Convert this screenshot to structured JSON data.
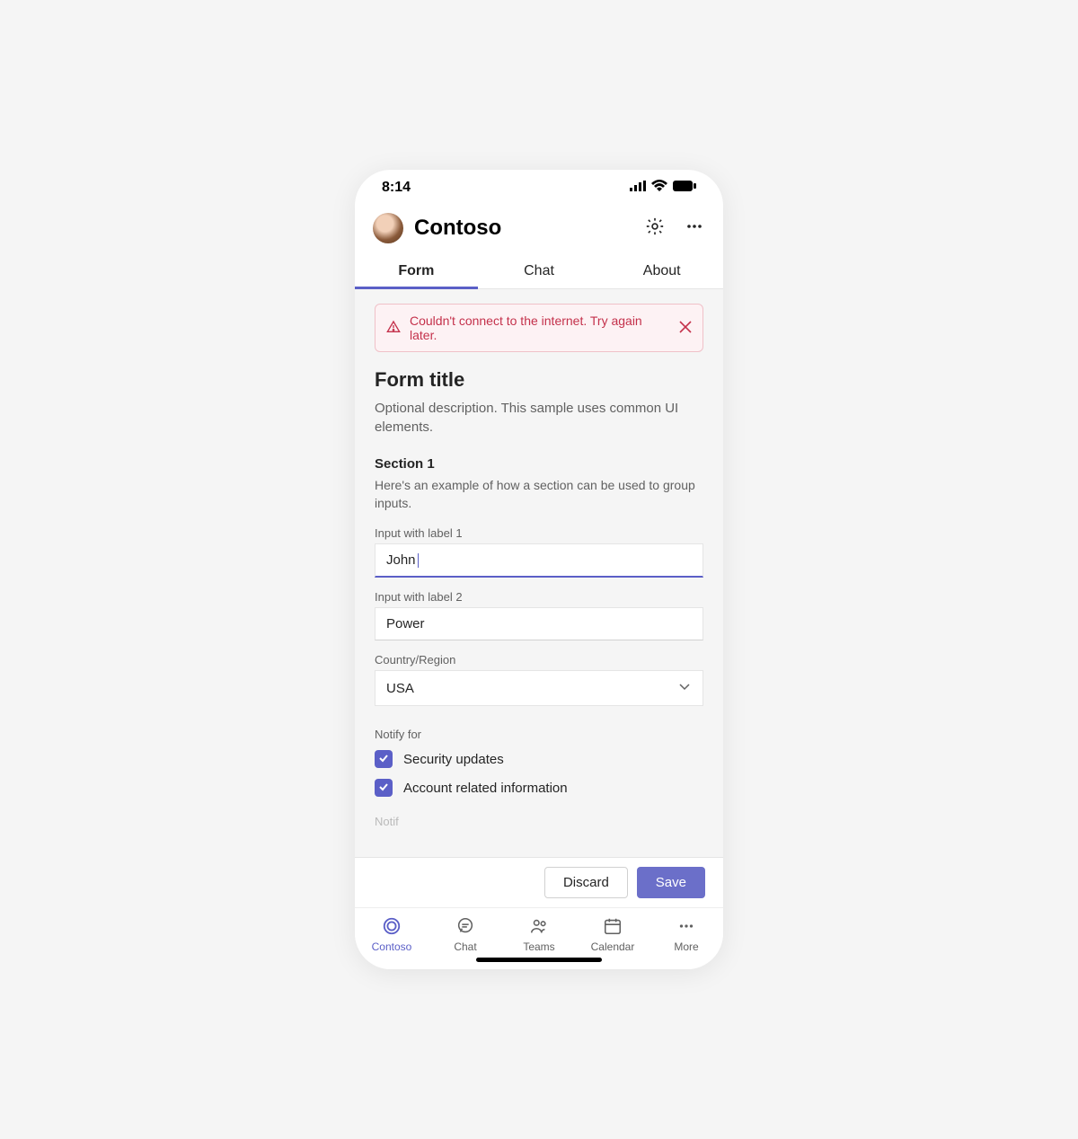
{
  "statusbar": {
    "time": "8:14"
  },
  "header": {
    "title": "Contoso"
  },
  "tabs": [
    {
      "label": "Form",
      "active": true
    },
    {
      "label": "Chat",
      "active": false
    },
    {
      "label": "About",
      "active": false
    }
  ],
  "alert": {
    "text": "Couldn't connect to the internet. Try again later."
  },
  "form": {
    "title": "Form title",
    "description": "Optional description. This sample uses common UI elements.",
    "section_title": "Section 1",
    "section_desc": "Here's an example of how a section can be used to group inputs.",
    "input1_label": "Input with label 1",
    "input1_value": "John",
    "input2_label": "Input with label 2",
    "input2_value": "Power",
    "country_label": "Country/Region",
    "country_value": "USA",
    "notify_label": "Notify for",
    "notify_options": [
      {
        "label": "Security updates",
        "checked": true
      },
      {
        "label": "Account related information",
        "checked": true
      }
    ],
    "cutoff_label": "Notif"
  },
  "actions": {
    "discard": "Discard",
    "save": "Save"
  },
  "nav": [
    {
      "label": "Contoso",
      "active": true
    },
    {
      "label": "Chat",
      "active": false
    },
    {
      "label": "Teams",
      "active": false
    },
    {
      "label": "Calendar",
      "active": false
    },
    {
      "label": "More",
      "active": false
    }
  ],
  "colors": {
    "accent": "#5b5fc7",
    "error": "#c4314b"
  }
}
